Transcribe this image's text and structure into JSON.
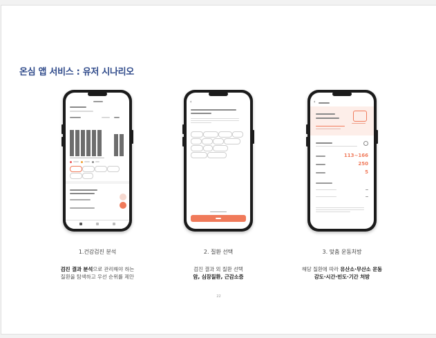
{
  "slide": {
    "title": "온심 앱 서비스 : 유저 시나리오",
    "page_number": "22"
  },
  "steps": [
    {
      "caption": "1.건강검진 분석",
      "desc_bold": "검진 결과 분석",
      "desc_line1_rest": "으로 관리해야 하는",
      "desc_line2": "질환을 탐색하고 우선 순위를 제안"
    },
    {
      "caption": "2. 질환 선택",
      "desc_line1": "검진 결과 외 질환 선택",
      "desc_line2_bold": "암, 심장질환, 근감소증"
    },
    {
      "caption": "3. 맞춤 운동처방",
      "desc_line1_plain": "해당 질환에 따라 ",
      "desc_line1_bold": "유산소·무산소 운동",
      "desc_line2_bold": "강도·시간·빈도·기간 처방"
    }
  ],
  "phone3": {
    "value1": "113~166",
    "value2": "250",
    "value3": "5"
  },
  "colors": {
    "title": "#2f4a8a",
    "accent": "#f07a5a",
    "accent_light": "#fdeee9"
  }
}
